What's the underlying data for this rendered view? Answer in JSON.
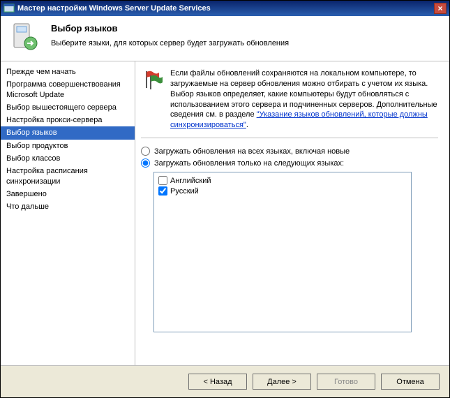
{
  "titlebar": {
    "text": "Мастер настройки Windows Server Update Services"
  },
  "header": {
    "title": "Выбор языков",
    "subtitle": "Выберите языки, для которых сервер будет загружать обновления"
  },
  "nav": {
    "items": [
      "Прежде чем начать",
      "Программа совершенствования Microsoft Update",
      "Выбор вышестоящего сервера",
      "Настройка прокси-сервера",
      "Выбор языков",
      "Выбор продуктов",
      "Выбор классов",
      "Настройка расписания синхронизации",
      "Завершено",
      "Что дальше"
    ],
    "selected_index": 4
  },
  "content": {
    "desc_prefix": "Если файлы обновлений сохраняются на локальном компьютере, то загружаемые на сервер обновления можно отбирать с учетом их языка. Выбор языков определяет, какие компьютеры будут обновляться с использованием этого сервера и подчиненных серверов. Дополнительные сведения см. в разделе ",
    "desc_link": "\"Указание языков обновлений, которые должны синхронизироваться\"",
    "desc_suffix": ".",
    "radio_all": "Загружать обновления на всех языках, включая новые",
    "radio_selected": "Загружать обновления только на следующих языках:",
    "radio_choice": "selected",
    "languages": [
      {
        "label": "Английский",
        "checked": false
      },
      {
        "label": "Русский",
        "checked": true
      }
    ]
  },
  "footer": {
    "back": "< Назад",
    "next": "Далее >",
    "finish": "Готово",
    "cancel": "Отмена",
    "finish_enabled": false
  }
}
